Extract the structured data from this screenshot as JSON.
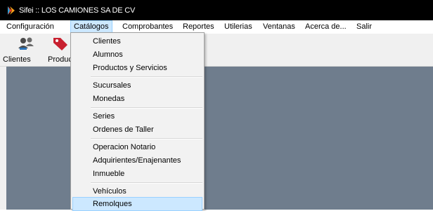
{
  "window": {
    "title": "Sifei :: LOS CAMIONES SA DE CV",
    "logo_icon": "sifei-logo-icon"
  },
  "menubar": {
    "items": [
      {
        "label": "Configuración"
      },
      {
        "label": "Catálogos",
        "active": true
      },
      {
        "label": "Comprobantes"
      },
      {
        "label": "Reportes"
      },
      {
        "label": "Utilerias"
      },
      {
        "label": "Ventanas"
      },
      {
        "label": "Acerca de..."
      },
      {
        "label": "Salir"
      }
    ]
  },
  "toolbar": {
    "buttons": [
      {
        "label": "Clientes",
        "icon": "users-icon"
      },
      {
        "label": "Productos",
        "icon": "price-tag-icon"
      }
    ]
  },
  "dropdown": {
    "items": [
      "Clientes",
      "Alumnos",
      "Productos y Servicios",
      "Sucursales",
      "Monedas",
      "Series",
      "Ordenes de Taller",
      "Operacion Notario",
      "Adquirientes/Enajenantes",
      "Inmueble",
      "Vehículos",
      "Remolques"
    ],
    "highlighted": "Remolques"
  },
  "colors": {
    "titlebar": "#000000",
    "workspace": "#6f7d8d",
    "highlight": "#cce8ff"
  }
}
